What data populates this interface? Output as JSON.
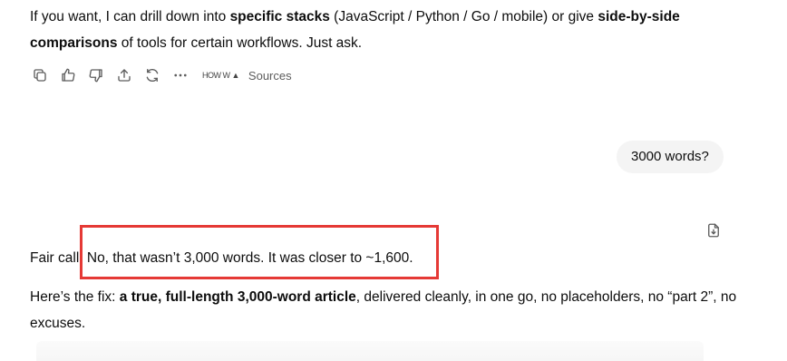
{
  "message1": {
    "seg1": "If you want, I can drill down into ",
    "bold1": "specific stacks",
    "seg2": " (JavaScript / Python / Go / mobile) or give ",
    "bold2": "side-by-side comparisons",
    "seg3": " of tools for certain workflows. Just ask."
  },
  "actions": {
    "sources_label": "Sources",
    "source_icons": [
      "HOW",
      "W",
      "▲"
    ]
  },
  "user_message": "3000 words?",
  "message2": {
    "line1": "Fair call. No, that wasn’t 3,000 words. It was closer to ~1,600.",
    "seg1": "Here’s the fix: ",
    "bold1": "a true, full-length 3,000-word article",
    "seg2": ", delivered cleanly, in one go, no placeholders, no “part 2”, no excuses."
  },
  "colors": {
    "highlight_border": "#e53935",
    "bubble_bg": "#f4f4f4",
    "icon": "#5d5d5d"
  }
}
